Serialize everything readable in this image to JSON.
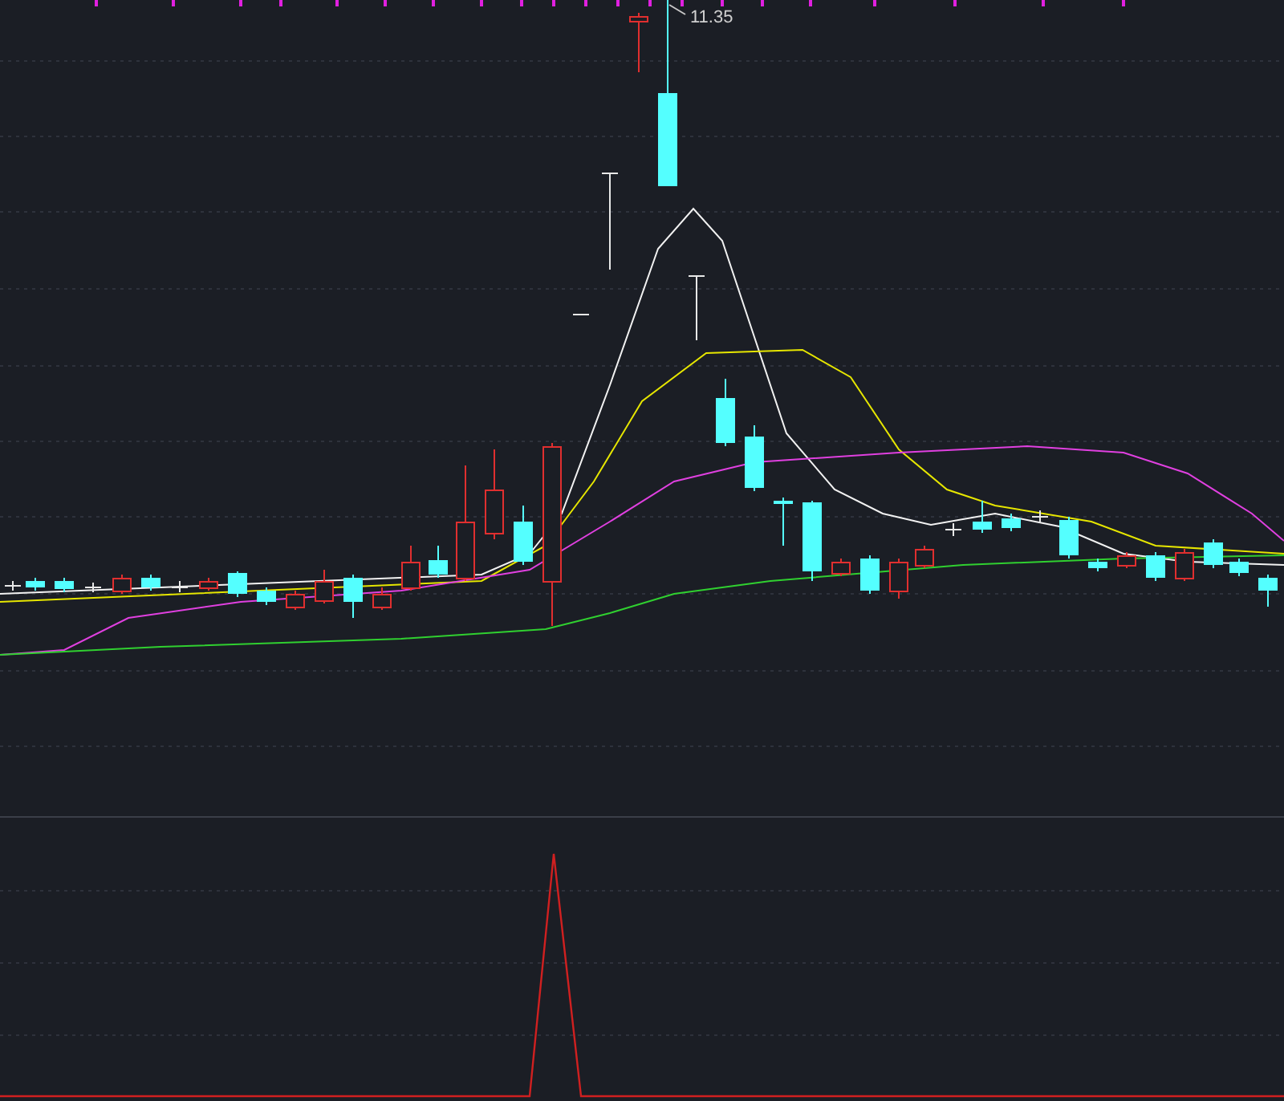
{
  "price_chart": {
    "high_label": "11.35"
  }
}
